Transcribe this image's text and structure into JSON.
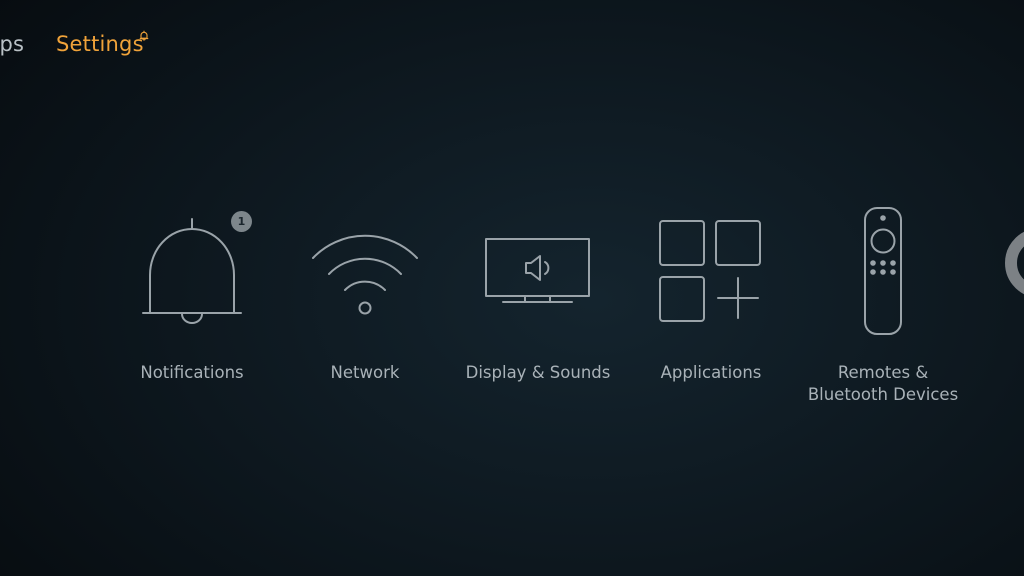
{
  "colors": {
    "accent": "#f0a33a",
    "icon_stroke": "#9aa3a9",
    "label": "#a9b2b8",
    "badge": "#7d868b"
  },
  "topnav": {
    "items": [
      {
        "label": "pps",
        "icon": "none"
      },
      {
        "label": "Settings",
        "icon": "bell-icon",
        "active": true
      }
    ]
  },
  "tiles": [
    {
      "label": "Notifications",
      "icon": "bell-icon",
      "badge": "1"
    },
    {
      "label": "Network",
      "icon": "wifi-icon"
    },
    {
      "label": "Display & Sounds",
      "icon": "tv-speaker-icon"
    },
    {
      "label": "Applications",
      "icon": "apps-grid-icon"
    },
    {
      "label": "Remotes &\nBluetooth Devices",
      "icon": "remote-icon"
    }
  ],
  "offscreen_tile": {
    "icon": "ring-icon"
  }
}
